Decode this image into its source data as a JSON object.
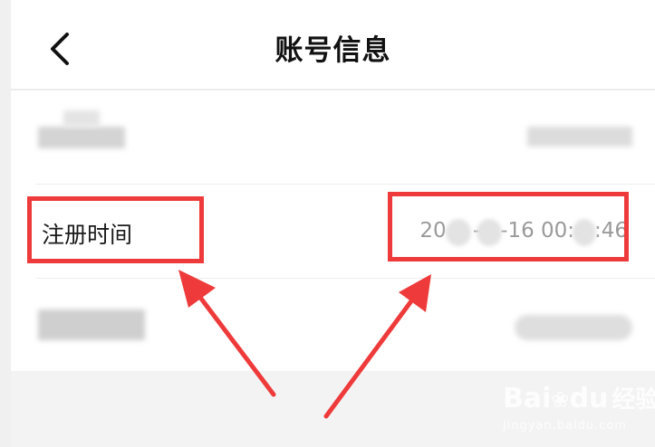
{
  "header": {
    "title": "账号信息",
    "back_icon": "chevron-left-icon"
  },
  "rows": [
    {
      "label": "",
      "value": ""
    },
    {
      "label": "注册时间",
      "value": "20    -   -16 00:   :46"
    },
    {
      "label": "",
      "value": ""
    }
  ],
  "annotation": {
    "color": "#ee3a3a"
  },
  "watermark": {
    "brand_text": "Bai",
    "brand_text2": "du",
    "cn_text": "经验",
    "url": "jingyan.baidu.com"
  }
}
